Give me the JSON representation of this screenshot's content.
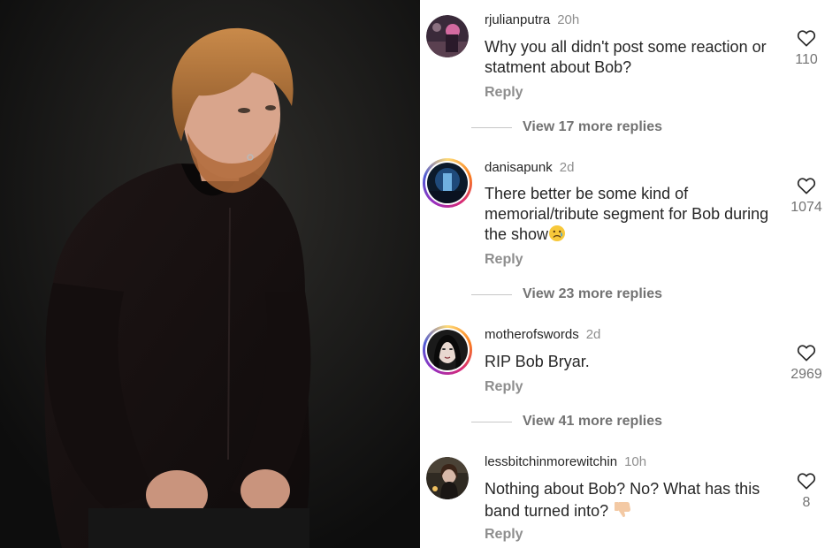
{
  "comments": [
    {
      "username": "rjulianputra",
      "time": "20h",
      "text": "Why you all didn't post some reaction or statment about Bob?",
      "reply_label": "Reply",
      "likes": "110",
      "view_more": "View 17 more replies",
      "avatar_ring": false
    },
    {
      "username": "danisapunk",
      "time": "2d",
      "text": "There better be some kind of memorial/tribute segment for Bob during the show",
      "emoji": "sad-face-emoji",
      "reply_label": "Reply",
      "likes": "1074",
      "view_more": "View 23 more replies",
      "avatar_ring": true
    },
    {
      "username": "motherofswords",
      "time": "2d",
      "text": "RIP Bob Bryar.",
      "reply_label": "Reply",
      "likes": "2969",
      "view_more": "View 41 more replies",
      "avatar_ring": true
    },
    {
      "username": "lessbitchinmorewitchin",
      "time": "10h",
      "text": "Nothing about Bob? No? What has this band turned into?",
      "emoji": "thumbs-down-emoji",
      "reply_label": "Reply",
      "likes": "8",
      "avatar_ring": false
    }
  ],
  "icons": {
    "like": "heart-outline-icon"
  },
  "colors": {
    "text": "#262626",
    "muted": "#8e8e8e",
    "ring_gradient": [
      "#feda75",
      "#fa7e1e",
      "#d62976",
      "#962fbf",
      "#4f5bd5"
    ]
  }
}
